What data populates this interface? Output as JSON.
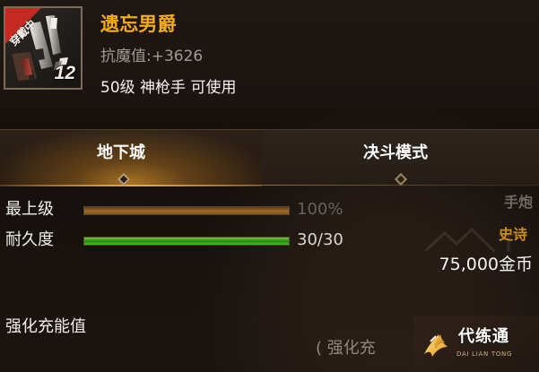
{
  "item": {
    "name": "遗忘男爵",
    "resist_label": "抗魔值:",
    "resist_value": "+3626",
    "requirement": "50级 神枪手 可使用",
    "equipped_badge": "穿戴中",
    "level_prefix": "",
    "level_value": "12"
  },
  "tabs": [
    {
      "label": "地下城",
      "active": true
    },
    {
      "label": "决斗模式",
      "active": false
    }
  ],
  "stats": {
    "top_grade": {
      "label": "最上级",
      "value": "100%",
      "fill": 1.0
    },
    "durability": {
      "label": "耐久度",
      "value": "30/30",
      "fill": 1.0
    },
    "weapon_type": "手炮",
    "grade_text": "史诗",
    "price": "75,000金币"
  },
  "enhance": {
    "label": "强化充能值",
    "bottom_text": "( 强化充"
  },
  "watermark": {
    "main": "代练通",
    "sub": "DAI LIAN TONG"
  },
  "colors": {
    "title": "#f2aa1f",
    "resist_text": "#9e9a93",
    "top_grade_fill": "#a16b26",
    "durability_fill": "#3bc11b",
    "grade_text": "#cb8f18"
  },
  "icons": {
    "item_icon": "gun-icon",
    "watermark_logo": "flame-logo-icon",
    "diamond_left": "diamond-marker-icon",
    "diamond_right": "diamond-marker-icon"
  }
}
